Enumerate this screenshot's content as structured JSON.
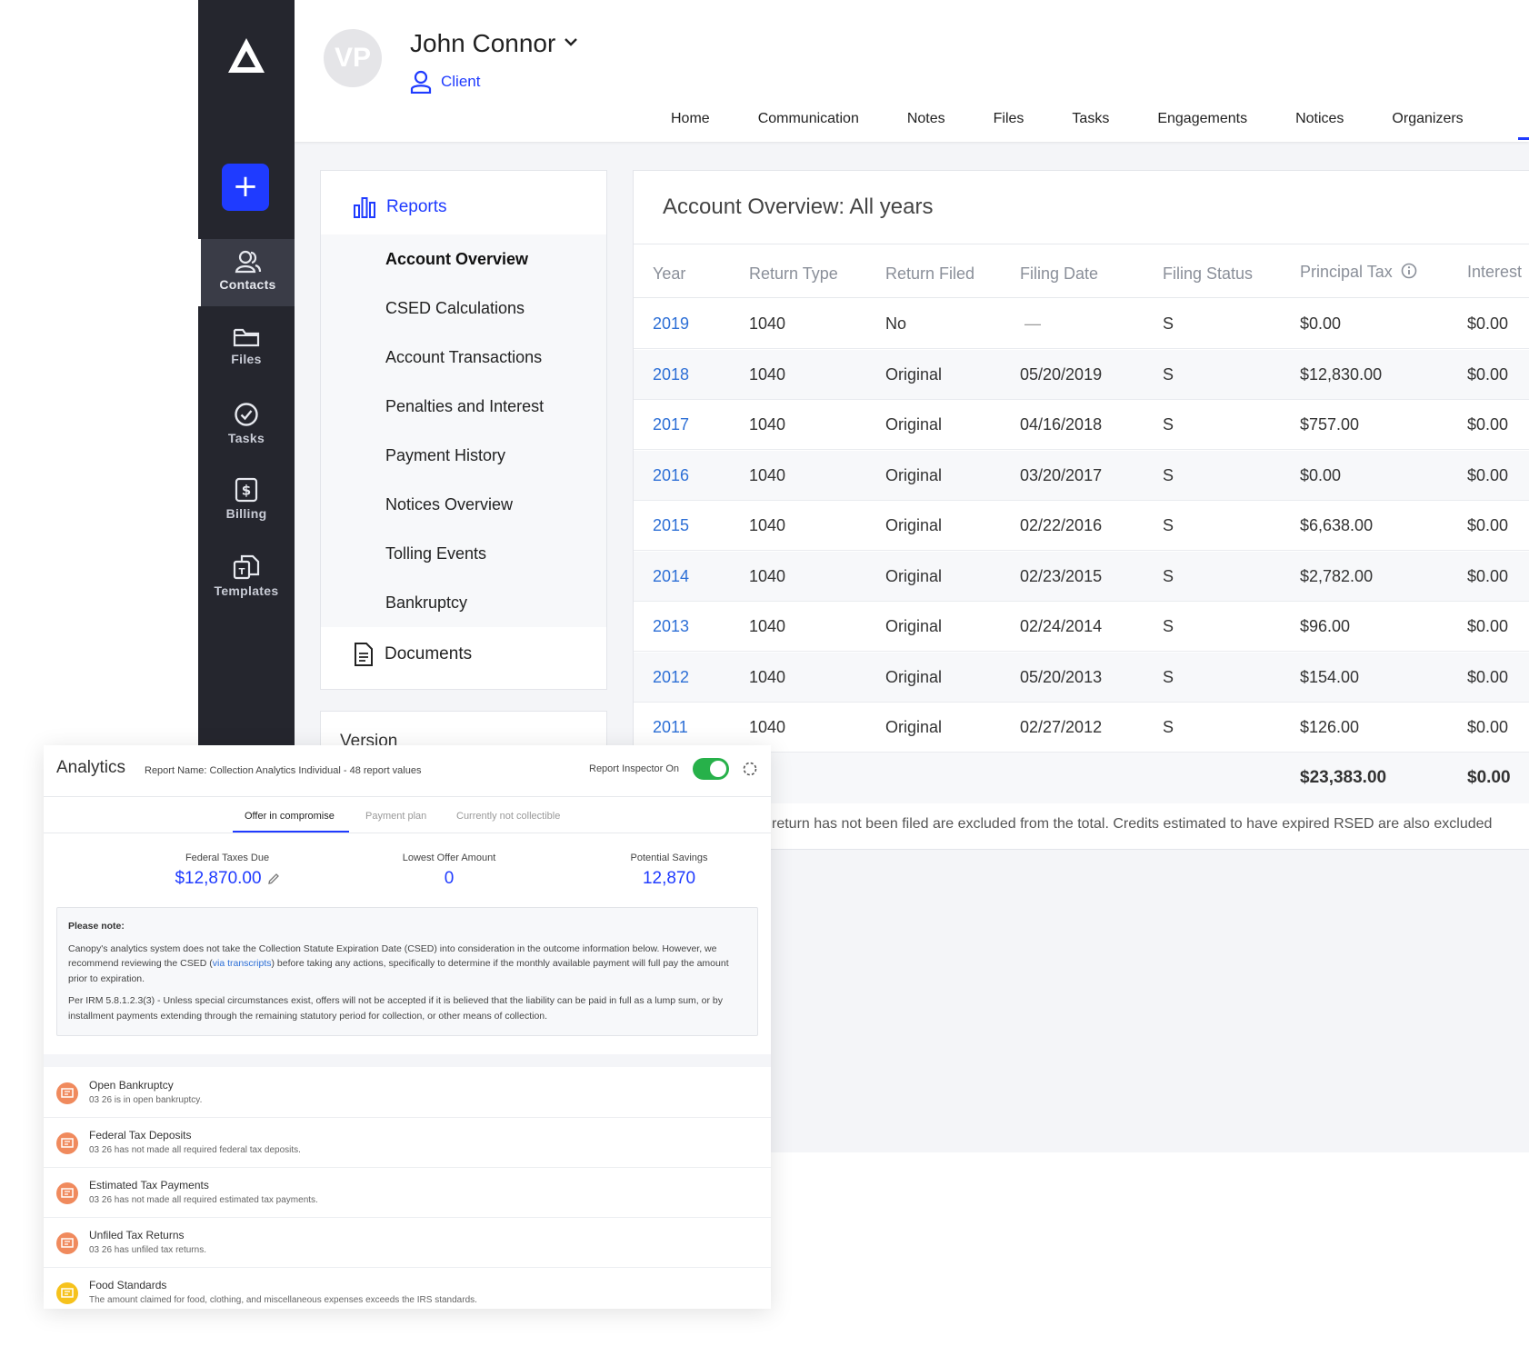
{
  "sidebar": {
    "add_label": "+",
    "items": [
      {
        "label": "Contacts",
        "icon": "contacts-icon",
        "active": true
      },
      {
        "label": "Files",
        "icon": "folder-icon"
      },
      {
        "label": "Tasks",
        "icon": "check-circle-icon"
      },
      {
        "label": "Billing",
        "icon": "dollar-icon"
      },
      {
        "label": "Templates",
        "icon": "templates-icon"
      }
    ]
  },
  "header": {
    "avatar_initials": "VP",
    "client_name": "John Connor",
    "client_role": "Client",
    "tabs": [
      "Home",
      "Communication",
      "Notes",
      "Files",
      "Tasks",
      "Engagements",
      "Notices",
      "Organizers"
    ]
  },
  "reports_menu": {
    "title": "Reports",
    "items": [
      "Account Overview",
      "CSED Calculations",
      "Account Transactions",
      "Penalties and Interest",
      "Payment History",
      "Notices Overview",
      "Tolling Events",
      "Bankruptcy"
    ],
    "active": "Account Overview",
    "documents": "Documents",
    "version": "Version"
  },
  "account_overview": {
    "title": "Account Overview: All years",
    "columns": [
      "Year",
      "Return Type",
      "Return Filed",
      "Filing Date",
      "Filing Status",
      "Principal Tax",
      "Interest"
    ],
    "rows": [
      {
        "year": "2019",
        "return_type": "1040",
        "return_filed": "No",
        "filing_date": "—",
        "filing_status": "S",
        "principal_tax": "$0.00",
        "interest": "$0.00"
      },
      {
        "year": "2018",
        "return_type": "1040",
        "return_filed": "Original",
        "filing_date": "05/20/2019",
        "filing_status": "S",
        "principal_tax": "$12,830.00",
        "interest": "$0.00"
      },
      {
        "year": "2017",
        "return_type": "1040",
        "return_filed": "Original",
        "filing_date": "04/16/2018",
        "filing_status": "S",
        "principal_tax": "$757.00",
        "interest": "$0.00"
      },
      {
        "year": "2016",
        "return_type": "1040",
        "return_filed": "Original",
        "filing_date": "03/20/2017",
        "filing_status": "S",
        "principal_tax": "$0.00",
        "interest": "$0.00"
      },
      {
        "year": "2015",
        "return_type": "1040",
        "return_filed": "Original",
        "filing_date": "02/22/2016",
        "filing_status": "S",
        "principal_tax": "$6,638.00",
        "interest": "$0.00"
      },
      {
        "year": "2014",
        "return_type": "1040",
        "return_filed": "Original",
        "filing_date": "02/23/2015",
        "filing_status": "S",
        "principal_tax": "$2,782.00",
        "interest": "$0.00"
      },
      {
        "year": "2013",
        "return_type": "1040",
        "return_filed": "Original",
        "filing_date": "02/24/2014",
        "filing_status": "S",
        "principal_tax": "$96.00",
        "interest": "$0.00"
      },
      {
        "year": "2012",
        "return_type": "1040",
        "return_filed": "Original",
        "filing_date": "05/20/2013",
        "filing_status": "S",
        "principal_tax": "$154.00",
        "interest": "$0.00"
      },
      {
        "year": "2011",
        "return_type": "1040",
        "return_filed": "Original",
        "filing_date": "02/27/2012",
        "filing_status": "S",
        "principal_tax": "$126.00",
        "interest": "$0.00"
      }
    ],
    "totals": {
      "principal_tax": "$23,383.00",
      "interest": "$0.00"
    },
    "footnote": "return has not been filed are excluded from the total. Credits estimated to have expired RSED are also excluded"
  },
  "analytics": {
    "title": "Analytics",
    "report_name": "Report Name: Collection Analytics Individual - 48 report values",
    "inspector_label": "Report Inspector On",
    "inspector_on": true,
    "tabs": [
      "Offer in compromise",
      "Payment plan",
      "Currently not collectible"
    ],
    "active_tab": "Offer in compromise",
    "metrics": [
      {
        "label": "Federal Taxes Due",
        "value": "$12,870.00"
      },
      {
        "label": "Lowest Offer Amount",
        "value": "0"
      },
      {
        "label": "Potential Savings",
        "value": "12,870"
      }
    ],
    "note": {
      "title": "Please note:",
      "p1_before": "Canopy's analytics system does not take the Collection Statute Expiration Date (CSED) into consideration in the outcome information below. However, we recommend reviewing the CSED (",
      "p1_link": "via transcripts",
      "p1_after": ") before taking any actions, specifically to determine if the monthly available payment will full pay the amount prior to expiration.",
      "p2": "Per IRM 5.8.1.2.3(3) - Unless special circumstances exist, offers will not be accepted if it is believed that the liability can be paid in full as a lump sum, or by installment payments extending through the remaining statutory period for collection, or other means of collection."
    },
    "flags": [
      {
        "title": "Open Bankruptcy",
        "desc": "03 26 is in open bankruptcy.",
        "color": "#f08a5d"
      },
      {
        "title": "Federal Tax Deposits",
        "desc": "03 26 has not made all required federal tax deposits.",
        "color": "#f08a5d"
      },
      {
        "title": "Estimated Tax Payments",
        "desc": "03 26 has not made all required estimated tax payments.",
        "color": "#f08a5d"
      },
      {
        "title": "Unfiled Tax Returns",
        "desc": "03 26 has unfiled tax returns.",
        "color": "#f08a5d"
      },
      {
        "title": "Food Standards",
        "desc": "The amount claimed for food, clothing, and miscellaneous expenses exceeds the IRS standards.",
        "color": "#f6c21c"
      }
    ]
  },
  "colors": {
    "accent": "#1f3bff",
    "sidebar": "#25262e",
    "link": "#2d6fd6",
    "toggle_on": "#27b14a"
  }
}
